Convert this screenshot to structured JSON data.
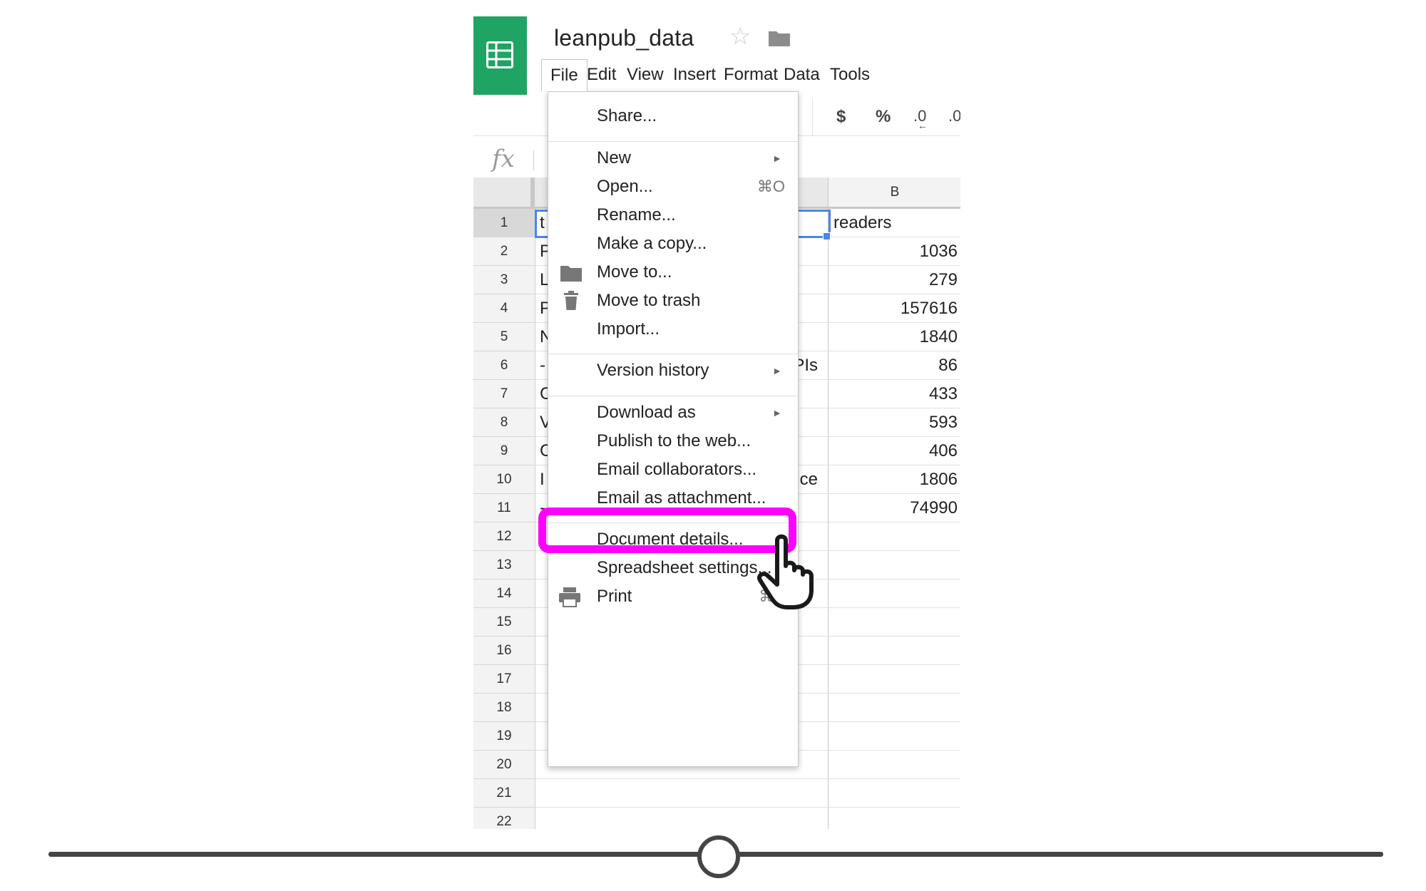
{
  "app": {
    "doc_title": "leanpub_data"
  },
  "menubar": {
    "items": [
      "File",
      "Edit",
      "View",
      "Insert",
      "Format",
      "Data",
      "Tools"
    ]
  },
  "toolbar": {
    "currency": "$",
    "percent": "%",
    "decrease_decimal": ".0",
    "increase_decimal": ".0"
  },
  "formula_bar": {
    "label": "fx"
  },
  "grid": {
    "column_b_header": "B",
    "rows": [
      {
        "num": "1",
        "a": "t",
        "a_peek": "",
        "b": "readers",
        "selected": true
      },
      {
        "num": "2",
        "a": "P",
        "a_peek": "",
        "b": "1036"
      },
      {
        "num": "3",
        "a": "L",
        "a_peek": "",
        "b": "279"
      },
      {
        "num": "4",
        "a": "P",
        "a_peek": "",
        "b": "157616"
      },
      {
        "num": "5",
        "a": "N",
        "a_peek": "",
        "b": "1840"
      },
      {
        "num": "6",
        "a": "-",
        "a_peek": "PIs",
        "b": "86"
      },
      {
        "num": "7",
        "a": "C",
        "a_peek": "",
        "b": "433"
      },
      {
        "num": "8",
        "a": "V",
        "a_peek": "",
        "b": "593"
      },
      {
        "num": "9",
        "a": "C",
        "a_peek": "",
        "b": "406"
      },
      {
        "num": "10",
        "a": "I",
        "a_peek": "nce",
        "b": "1806"
      },
      {
        "num": "11",
        "a": "-",
        "a_peek": "",
        "b": "74990"
      },
      {
        "num": "12",
        "a": "",
        "a_peek": "",
        "b": ""
      },
      {
        "num": "13",
        "a": "",
        "a_peek": "",
        "b": ""
      },
      {
        "num": "14",
        "a": "",
        "a_peek": "",
        "b": ""
      },
      {
        "num": "15",
        "a": "",
        "a_peek": "",
        "b": ""
      },
      {
        "num": "16",
        "a": "",
        "a_peek": "",
        "b": ""
      },
      {
        "num": "17",
        "a": "",
        "a_peek": "",
        "b": ""
      },
      {
        "num": "18",
        "a": "",
        "a_peek": "",
        "b": ""
      },
      {
        "num": "19",
        "a": "",
        "a_peek": "",
        "b": ""
      },
      {
        "num": "20",
        "a": "",
        "a_peek": "",
        "b": ""
      },
      {
        "num": "21",
        "a": "",
        "a_peek": "",
        "b": ""
      },
      {
        "num": "22",
        "a": "",
        "a_peek": "",
        "b": ""
      }
    ]
  },
  "file_menu": {
    "share": "Share...",
    "new": "New",
    "open": "Open...",
    "open_shortcut": "⌘O",
    "rename": "Rename...",
    "make_copy": "Make a copy...",
    "move_to": "Move to...",
    "move_to_trash": "Move to trash",
    "import": "Import...",
    "version_history": "Version history",
    "download_as": "Download as",
    "publish_to_web": "Publish to the web...",
    "email_collaborators": "Email collaborators...",
    "email_attachment": "Email as attachment...",
    "document_details": "Document details...",
    "spreadsheet_settings": "Spreadsheet settings...",
    "print": "Print",
    "print_shortcut": "⌘P",
    "submenu_arrow": "►"
  },
  "icons": {
    "logo": "sheets-logo-icon",
    "star": "star-icon",
    "folder": "folder-icon",
    "trash": "trash-icon",
    "print": "printer-icon",
    "cursor": "hand-pointer-icon"
  },
  "colors": {
    "brand_green": "#1fa463",
    "highlight_magenta": "#ff00ff",
    "selection_blue": "#4a86e8"
  },
  "timeline": {
    "position_fraction": 0.5
  }
}
